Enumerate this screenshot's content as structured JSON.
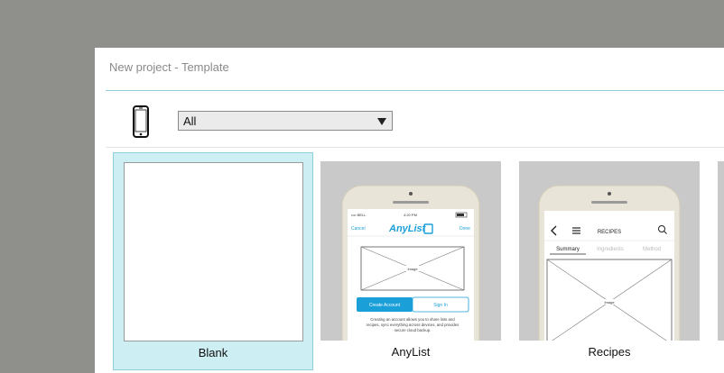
{
  "dialog": {
    "title": "New project - Template"
  },
  "filter": {
    "device_icon": "phone-icon",
    "selected": "All"
  },
  "templates": [
    {
      "label": "Blank"
    },
    {
      "label": "AnyList",
      "screen": {
        "status_carrier": "•••• BELL",
        "status_time": "4:20 PM",
        "nav_left": "Cancel",
        "logo": "AnyList",
        "nav_right": "Done",
        "image_label": "Image",
        "btn_primary": "Create Account",
        "btn_secondary": "Sign In",
        "body_text": [
          "Creating an account allows you to share lists and",
          "recipes, sync everything across devices, and provides",
          "secure cloud backup."
        ]
      }
    },
    {
      "label": "Recipes",
      "screen": {
        "header": "RECIPES",
        "tabs": [
          "Summary",
          "Ingredients",
          "Method"
        ],
        "image_label": "Image"
      }
    }
  ],
  "colors": {
    "accent": "#8fd0dc",
    "selected_bg": "#cdeef2",
    "overlay": "#8f8f8b",
    "anylist_blue": "#1b9fd9"
  }
}
